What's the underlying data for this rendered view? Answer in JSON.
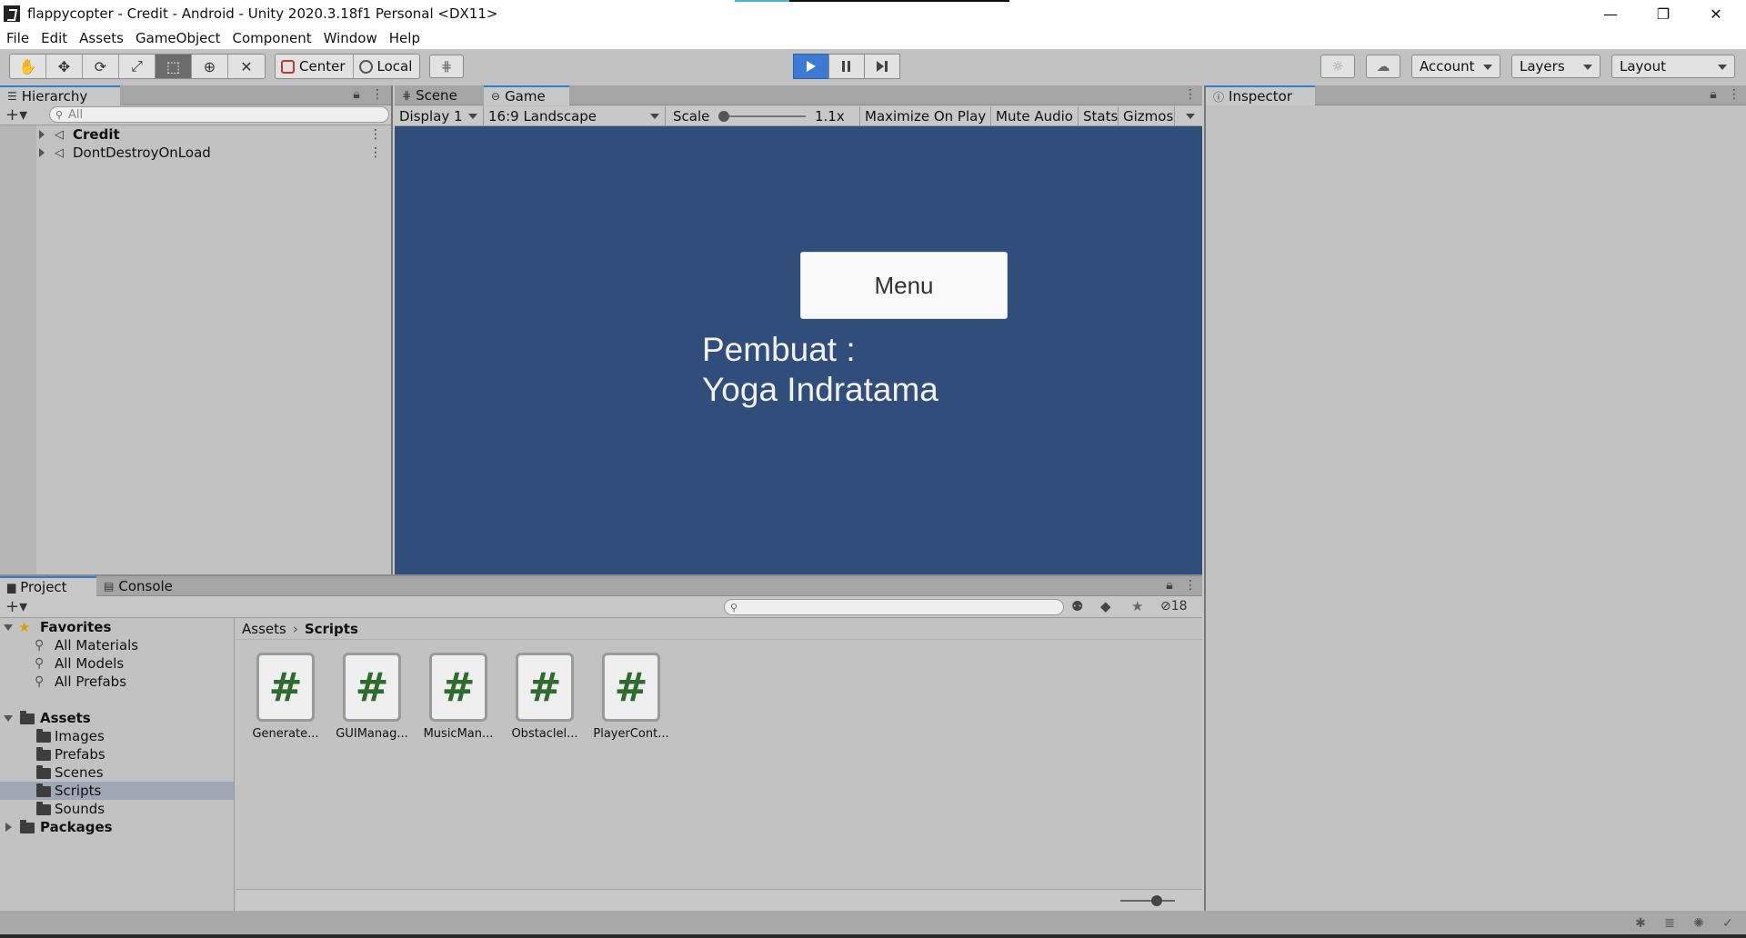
{
  "window": {
    "title": "flappycopter - Credit - Android - Unity 2020.3.18f1 Personal <DX11>",
    "minimize": "—",
    "restore": "❐",
    "close": "✕"
  },
  "menu": [
    "File",
    "Edit",
    "Assets",
    "GameObject",
    "Component",
    "Window",
    "Help"
  ],
  "toolbar": {
    "tools": [
      "hand-icon",
      "move-icon",
      "rotate-icon",
      "scale-icon",
      "rect-icon",
      "transform-icon",
      "custom-tool-icon"
    ],
    "active_tool_index": 4,
    "pivot_center": "Center",
    "pivot_local": "Local",
    "account": "Account",
    "layers": "Layers",
    "layout": "Layout"
  },
  "hierarchy": {
    "tab": "Hierarchy",
    "search_placeholder": "All",
    "items": [
      {
        "label": "Credit",
        "bold": true
      },
      {
        "label": "DontDestroyOnLoad",
        "bold": false
      }
    ]
  },
  "game": {
    "tab_scene": "Scene",
    "tab_game": "Game",
    "display": "Display 1",
    "aspect": "16:9 Landscape",
    "scale_label": "Scale",
    "scale_value": "1.1x",
    "maximize": "Maximize On Play",
    "mute": "Mute Audio",
    "stats": "Stats",
    "gizmos": "Gizmos",
    "menu_button": "Menu",
    "credit_line1": "Pembuat :",
    "credit_line2": "Yoga Indratama",
    "background": "#314e7b"
  },
  "inspector": {
    "tab": "Inspector"
  },
  "project": {
    "tab_project": "Project",
    "tab_console": "Console",
    "hidden_count": "18",
    "favorites_label": "Favorites",
    "favorites": [
      "All Materials",
      "All Models",
      "All Prefabs"
    ],
    "assets_label": "Assets",
    "folders": [
      "Images",
      "Prefabs",
      "Scenes",
      "Scripts",
      "Sounds"
    ],
    "selected_folder": "Scripts",
    "packages_label": "Packages",
    "breadcrumb_root": "Assets",
    "breadcrumb_current": "Scripts",
    "scripts": [
      "Generate...",
      "GUIManag...",
      "MusicMan...",
      "Obstaclel...",
      "PlayerCont..."
    ]
  }
}
